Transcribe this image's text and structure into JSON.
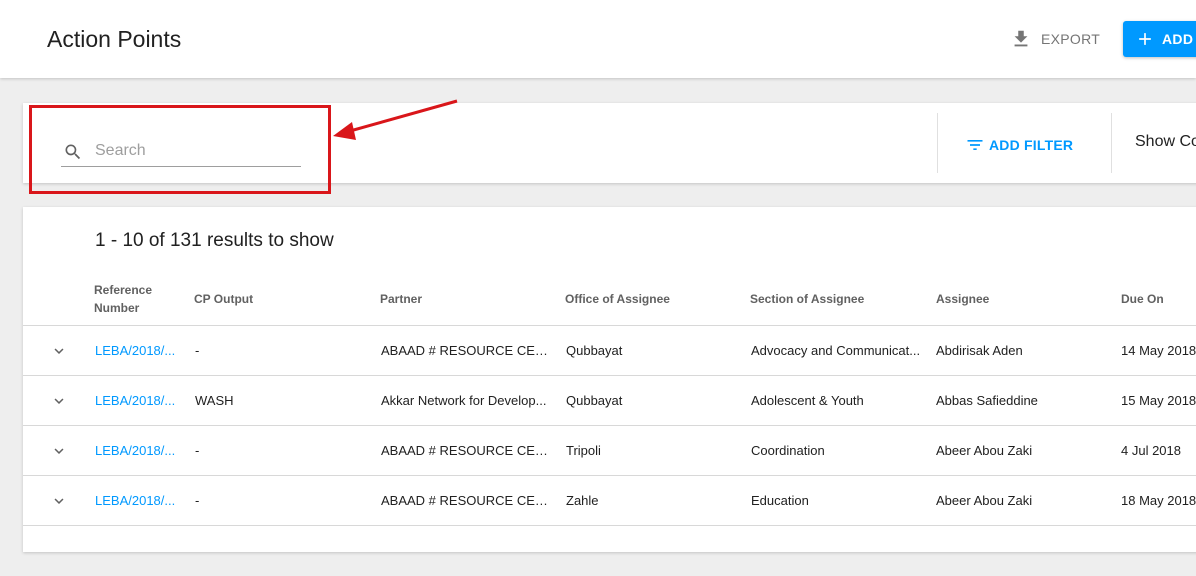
{
  "header": {
    "title": "Action Points",
    "export_label": "EXPORT",
    "add_label": "ADD A"
  },
  "filters": {
    "search_placeholder": "Search",
    "search_value": "",
    "add_filter_label": "ADD FILTER",
    "show_columns_label": "Show Co"
  },
  "results": {
    "count_text": "1 - 10 of 131 results to show",
    "columns": [
      {
        "label": "Reference Number"
      },
      {
        "label": "CP Output"
      },
      {
        "label": "Partner"
      },
      {
        "label": "Office of Assignee"
      },
      {
        "label": "Section of Assignee"
      },
      {
        "label": "Assignee"
      },
      {
        "label": "Due On"
      }
    ],
    "rows": [
      {
        "reference": "LEBA/2018/...",
        "cp_output": "-",
        "partner": "ABAAD # RESOURCE CENT...",
        "office": "Qubbayat",
        "section": "Advocacy and Communicat...",
        "assignee": "Abdirisak Aden",
        "due_on": "14 May 2018"
      },
      {
        "reference": "LEBA/2018/...",
        "cp_output": "WASH",
        "partner": "Akkar Network for Develop...",
        "office": "Qubbayat",
        "section": "Adolescent & Youth",
        "assignee": "Abbas Safieddine",
        "due_on": "15 May 2018"
      },
      {
        "reference": "LEBA/2018/...",
        "cp_output": "-",
        "partner": "ABAAD # RESOURCE CENT...",
        "office": "Tripoli",
        "section": "Coordination",
        "assignee": "Abeer Abou Zaki",
        "due_on": "4 Jul 2018"
      },
      {
        "reference": "LEBA/2018/...",
        "cp_output": "-",
        "partner": "ABAAD # RESOURCE CENT...",
        "office": "Zahle",
        "section": "Education",
        "assignee": "Abeer Abou Zaki",
        "due_on": "18 May 2018"
      }
    ]
  },
  "colors": {
    "accent": "#0099ff",
    "annotation": "#d9161a"
  },
  "icons": {
    "export": "download-icon",
    "add": "plus-icon",
    "search": "search-icon",
    "filter": "filter-list-icon",
    "expand": "chevron-down-icon"
  }
}
